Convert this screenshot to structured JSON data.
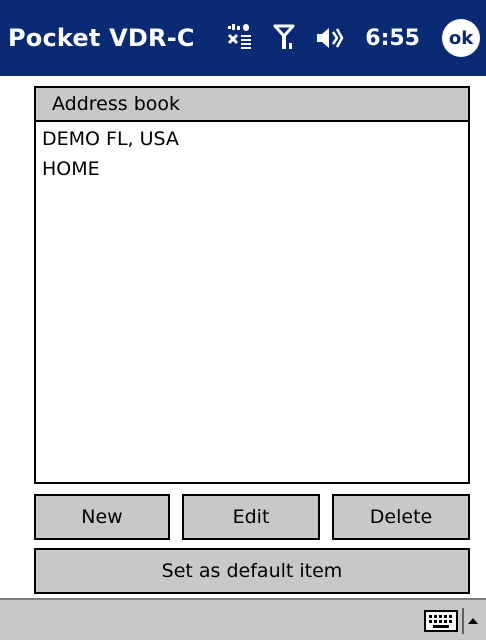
{
  "titlebar": {
    "app_title": "Pocket VDR-C",
    "clock": "6:55",
    "ok_label": "ok"
  },
  "address_book": {
    "header": "Address book",
    "items": [
      "DEMO FL, USA",
      "HOME"
    ]
  },
  "buttons": {
    "new": "New",
    "edit": "Edit",
    "delete": "Delete",
    "set_default": "Set as default item"
  },
  "icons": [
    "sync-status-icon",
    "signal-icon",
    "speaker-icon",
    "ok-icon",
    "keyboard-icon",
    "sip-up-arrow-icon"
  ],
  "colors": {
    "titlebar": "#0a2a73",
    "button_face": "#c8c8c8"
  }
}
